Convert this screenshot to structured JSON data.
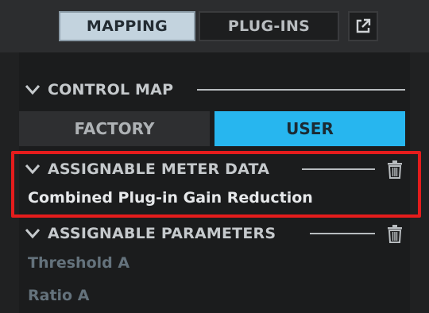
{
  "toolbar": {
    "tabs": [
      {
        "label": "MAPPING",
        "active": true
      },
      {
        "label": "PLUG-INS",
        "active": false
      }
    ],
    "popout_icon": "external-window-icon"
  },
  "control_map": {
    "title": "CONTROL MAP",
    "modes": [
      {
        "label": "FACTORY",
        "selected": false
      },
      {
        "label": "USER",
        "selected": true
      }
    ]
  },
  "assignable_meter_data": {
    "title": "ASSIGNABLE METER DATA",
    "value": "Combined Plug-in Gain Reduction",
    "delete_icon": "trash-icon"
  },
  "assignable_parameters": {
    "title": "ASSIGNABLE PARAMETERS",
    "items": [
      "Threshold A",
      "Ratio A"
    ],
    "delete_icon": "trash-icon"
  },
  "colors": {
    "accent": "#27b6ef",
    "highlight": "#e51c1c",
    "active_tab": "#c3d3de"
  }
}
